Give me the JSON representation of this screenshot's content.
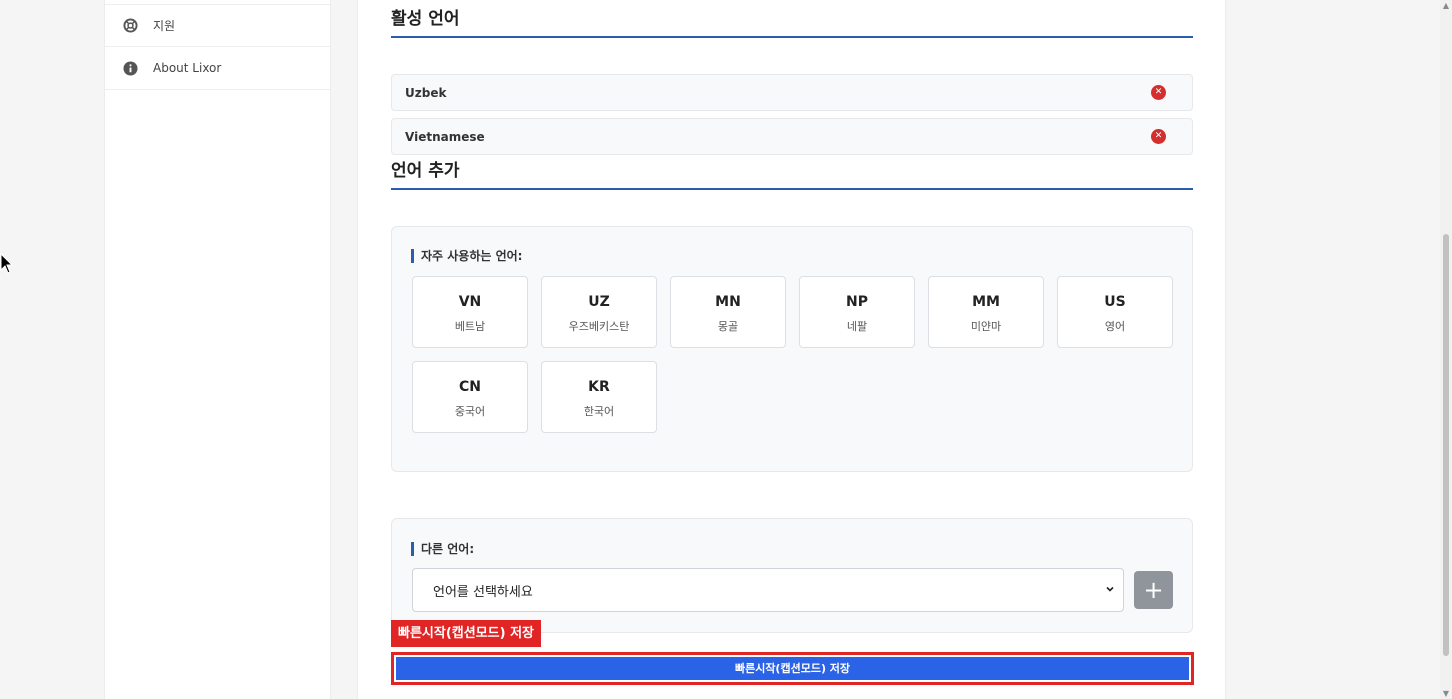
{
  "sidebar": {
    "items": [
      {
        "label": "지원",
        "icon": "lifebuoy-icon"
      },
      {
        "label": "About Lixor",
        "icon": "info-icon"
      }
    ]
  },
  "active_languages": {
    "title": "활성 언어",
    "items": [
      {
        "label": "Uzbek"
      },
      {
        "label": "Vietnamese"
      }
    ]
  },
  "add_language": {
    "title": "언어 추가",
    "frequent": {
      "label": "자주 사용하는 언어:",
      "items": [
        {
          "code": "VN",
          "name": "베트남"
        },
        {
          "code": "UZ",
          "name": "우즈베키스탄"
        },
        {
          "code": "MN",
          "name": "몽골"
        },
        {
          "code": "NP",
          "name": "네팔"
        },
        {
          "code": "MM",
          "name": "미얀마"
        },
        {
          "code": "US",
          "name": "영어"
        },
        {
          "code": "CN",
          "name": "중국어"
        },
        {
          "code": "KR",
          "name": "한국어"
        }
      ]
    },
    "other": {
      "label": "다른 언어:",
      "select_value": "언어를 선택하세요",
      "add_symbol": "+"
    }
  },
  "highlight_label": "빠른시작(캡션모드) 저장",
  "save_button": {
    "label": "빠른시작(캡션모드) 저장"
  },
  "colors": {
    "accent": "#2b5dad",
    "danger": "#d32f2f",
    "save": "#2b63e6",
    "highlight": "#e12525"
  }
}
